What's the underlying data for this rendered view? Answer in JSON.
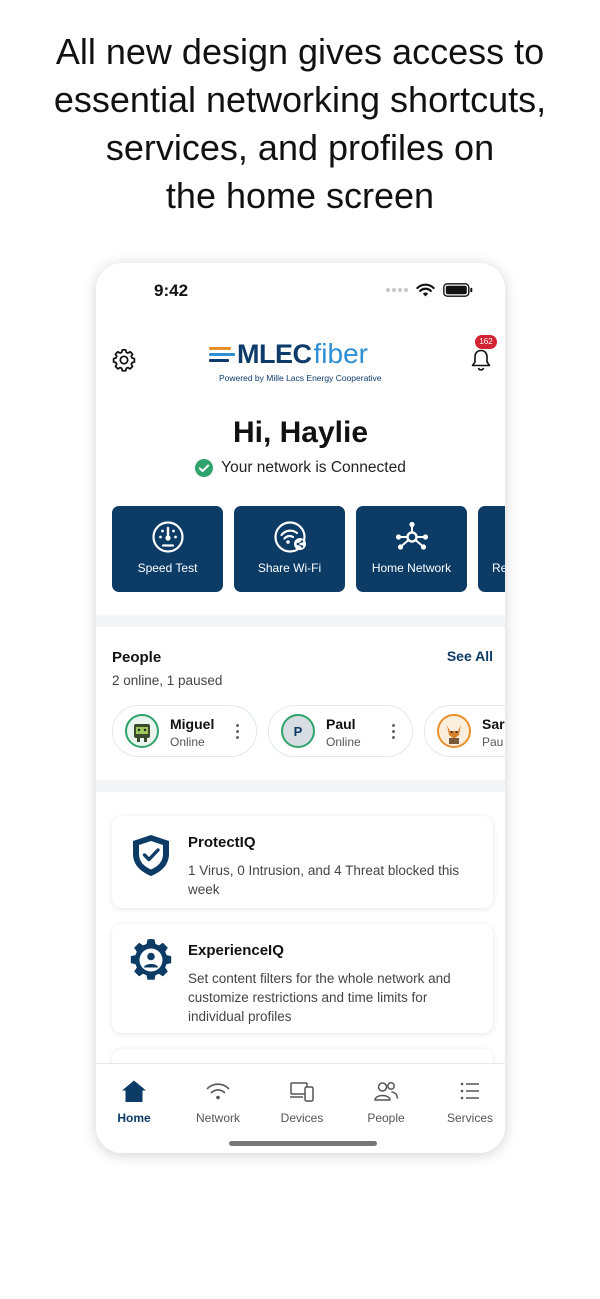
{
  "headline": {
    "lines": [
      "All new design gives access to",
      "essential networking shortcuts,",
      "services, and profiles on",
      "the home screen"
    ]
  },
  "status_bar": {
    "time": "9:42"
  },
  "header": {
    "logo_main": "MLEC",
    "logo_accent": "fiber",
    "logo_sub": "Powered by Mille Lacs Energy Cooperative",
    "notification_count": "162"
  },
  "greeting": "Hi, Haylie",
  "connection_status": "Your network is Connected",
  "quick_actions": [
    {
      "label": "Speed Test",
      "icon": "speedometer-icon"
    },
    {
      "label": "Share Wi-Fi",
      "icon": "share-wifi-icon"
    },
    {
      "label": "Home Network",
      "icon": "network-hub-icon"
    },
    {
      "label": "Re",
      "icon": ""
    }
  ],
  "people": {
    "title": "People",
    "see_all": "See All",
    "summary": "2 online, 1 paused",
    "profiles": [
      {
        "name": "Miguel",
        "status": "Online",
        "initial": ""
      },
      {
        "name": "Paul",
        "status": "Online",
        "initial": "P"
      },
      {
        "name": "Sar",
        "status": "Pau",
        "initial": ""
      }
    ]
  },
  "services": [
    {
      "title": "ProtectIQ",
      "description": "1 Virus, 0 Intrusion, and 4 Threat blocked this week",
      "icon": "shield-check-icon"
    },
    {
      "title": "ExperienceIQ",
      "description": "Set content filters for the whole network and customize restrictions and time limits for individual profiles",
      "icon": "gear-person-icon"
    }
  ],
  "tabs": [
    {
      "label": "Home",
      "icon": "home-icon",
      "active": true
    },
    {
      "label": "Network",
      "icon": "wifi-icon",
      "active": false
    },
    {
      "label": "Devices",
      "icon": "devices-icon",
      "active": false
    },
    {
      "label": "People",
      "icon": "people-icon",
      "active": false
    },
    {
      "label": "Services",
      "icon": "list-icon",
      "active": false
    }
  ],
  "colors": {
    "brand_navy": "#0c3b66",
    "brand_blue": "#2f8fd4",
    "logo_orange": "#e8902b",
    "badge_red": "#d32331",
    "connected_green": "#2fa36b"
  }
}
